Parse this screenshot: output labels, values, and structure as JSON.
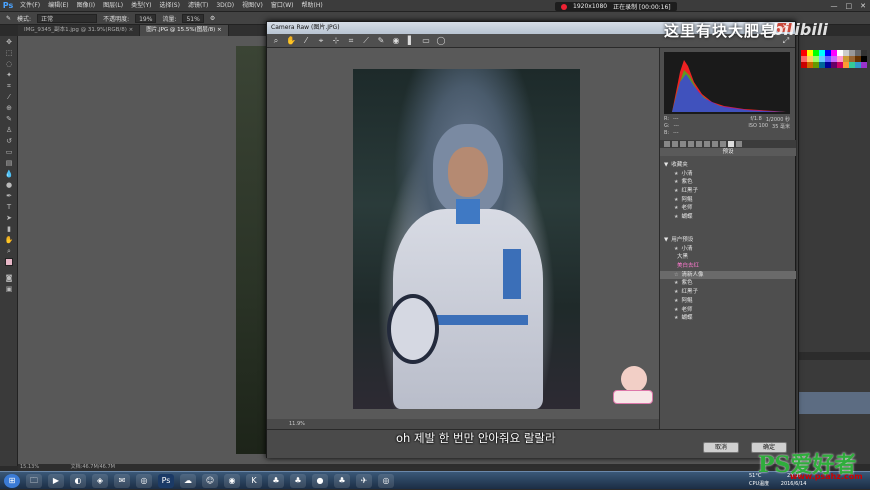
{
  "menubar": {
    "logo": "Ps",
    "items": [
      "文件(F)",
      "编辑(E)",
      "图像(I)",
      "图层(L)",
      "类型(Y)",
      "选择(S)",
      "滤镜(T)",
      "3D(D)",
      "视图(V)",
      "窗口(W)",
      "帮助(H)"
    ],
    "recording": {
      "resolution": "1920x1080",
      "status": "正在录制 [00:00:16]"
    },
    "window_controls": [
      "—",
      "□",
      "✕"
    ]
  },
  "options_bar": {
    "mode_label": "模式:",
    "mode_value": "正常",
    "opacity_label": "不透明度:",
    "opacity_value": "19%",
    "flow_label": "流量:",
    "flow_value": "51%"
  },
  "doc_tabs": [
    "IMG_9345_副本1.jpg @ 31.9%(RGB/8) ×",
    "图片.JPG @ 15.5%(图层/8) ×"
  ],
  "overlay": {
    "title": "这里有块大肥皂",
    "brand": "bilibili"
  },
  "camera_raw": {
    "title": "Camera Raw (图片.JPG)",
    "close": "✕",
    "readout": {
      "r": "R:",
      "g": "G:",
      "b": "B:",
      "r_val": "---",
      "g_val": "---",
      "b_val": "---",
      "aperture": "f/1.8",
      "shutter": "1/2000 秒",
      "iso": "ISO 100",
      "focal": "35 毫米"
    },
    "panel_title": "预设",
    "groups": [
      {
        "name": "收藏夹",
        "items": [
          "小清",
          "紫色",
          "红黑子",
          "阿鲲",
          "老师",
          "蝴蝶"
        ]
      },
      {
        "name": "用户预设",
        "items": [
          "小清",
          "大黑",
          "美白去红",
          "清新人像",
          "紫色",
          "红黑子",
          "阿鲲",
          "老师",
          "蝴蝶"
        ]
      }
    ],
    "selected_item": "清新人像",
    "highlighted_item": "美白去红",
    "zoom": "11.9%",
    "cancel": "取消",
    "ok": "确定"
  },
  "subtitle": "oh 제발 한 번만 안아줘요 랄랄라",
  "status_bar": {
    "zoom": "15.13%",
    "doc": "文档:46.7M/46.7M"
  },
  "taskbar": {
    "temp": "51°C",
    "cpu": "CPU温度",
    "time": "23:36",
    "date": "2016/6/14"
  },
  "watermark": {
    "text": "PS爱好者",
    "url": "www.psahz.com"
  }
}
